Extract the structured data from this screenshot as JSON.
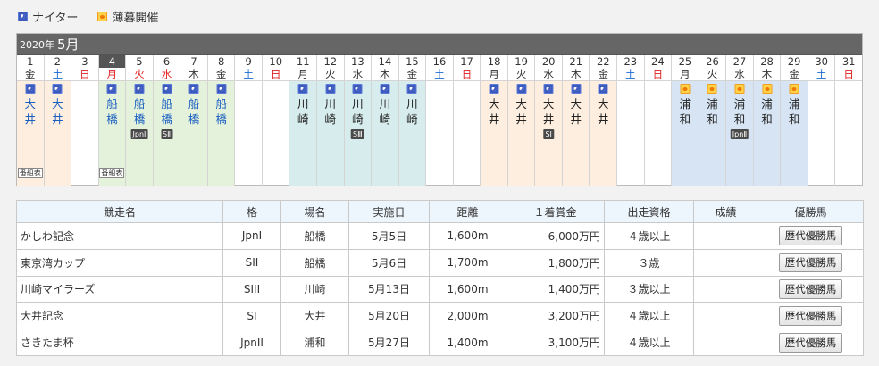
{
  "legend": {
    "night_label": "ナイター",
    "dusk_label": "薄暮開催"
  },
  "calendar": {
    "year": "2020年",
    "month": "5月",
    "days": [
      {
        "num": "1",
        "dow": "金",
        "type": "wk",
        "venue": "大井",
        "icon": "night",
        "bg": "oi",
        "vcls": "oi1",
        "prog": "番組表"
      },
      {
        "num": "2",
        "dow": "土",
        "type": "sat",
        "venue": "大井",
        "icon": "night",
        "bg": "oi",
        "vcls": "oi1"
      },
      {
        "num": "3",
        "dow": "日",
        "type": "sun"
      },
      {
        "num": "4",
        "dow": "月",
        "type": "sun",
        "today": true,
        "venue": "船橋",
        "icon": "night",
        "bg": "funa",
        "vcls": "funa",
        "prog": "番組表"
      },
      {
        "num": "5",
        "dow": "火",
        "type": "sun",
        "venue": "船橋",
        "icon": "night",
        "bg": "funa",
        "vcls": "funa",
        "grade": "JpnⅠ"
      },
      {
        "num": "6",
        "dow": "水",
        "type": "sun",
        "venue": "船橋",
        "icon": "night",
        "bg": "funa",
        "vcls": "funa",
        "grade": "SⅡ"
      },
      {
        "num": "7",
        "dow": "木",
        "type": "wk",
        "venue": "船橋",
        "icon": "night",
        "bg": "funa",
        "vcls": "funa"
      },
      {
        "num": "8",
        "dow": "金",
        "type": "wk",
        "venue": "船橋",
        "icon": "night",
        "bg": "funa",
        "vcls": "funa"
      },
      {
        "num": "9",
        "dow": "土",
        "type": "sat"
      },
      {
        "num": "10",
        "dow": "日",
        "type": "sun"
      },
      {
        "num": "11",
        "dow": "月",
        "type": "wk",
        "venue": "川崎",
        "icon": "night",
        "bg": "kawa",
        "vcls": "kawa"
      },
      {
        "num": "12",
        "dow": "火",
        "type": "wk",
        "venue": "川崎",
        "icon": "night",
        "bg": "kawa",
        "vcls": "kawa"
      },
      {
        "num": "13",
        "dow": "水",
        "type": "wk",
        "venue": "川崎",
        "icon": "night",
        "bg": "kawa",
        "vcls": "kawa",
        "grade": "SⅢ"
      },
      {
        "num": "14",
        "dow": "木",
        "type": "wk",
        "venue": "川崎",
        "icon": "night",
        "bg": "kawa",
        "vcls": "kawa"
      },
      {
        "num": "15",
        "dow": "金",
        "type": "wk",
        "venue": "川崎",
        "icon": "night",
        "bg": "kawa",
        "vcls": "kawa"
      },
      {
        "num": "16",
        "dow": "土",
        "type": "sat"
      },
      {
        "num": "17",
        "dow": "日",
        "type": "sun"
      },
      {
        "num": "18",
        "dow": "月",
        "type": "wk",
        "venue": "大井",
        "icon": "night",
        "bg": "oi",
        "vcls": "oi"
      },
      {
        "num": "19",
        "dow": "火",
        "type": "wk",
        "venue": "大井",
        "icon": "night",
        "bg": "oi",
        "vcls": "oi"
      },
      {
        "num": "20",
        "dow": "水",
        "type": "wk",
        "venue": "大井",
        "icon": "night",
        "bg": "oi",
        "vcls": "oi",
        "grade": "SⅠ"
      },
      {
        "num": "21",
        "dow": "木",
        "type": "wk",
        "venue": "大井",
        "icon": "night",
        "bg": "oi",
        "vcls": "oi"
      },
      {
        "num": "22",
        "dow": "金",
        "type": "wk",
        "venue": "大井",
        "icon": "night",
        "bg": "oi",
        "vcls": "oi"
      },
      {
        "num": "23",
        "dow": "土",
        "type": "sat"
      },
      {
        "num": "24",
        "dow": "日",
        "type": "sun"
      },
      {
        "num": "25",
        "dow": "月",
        "type": "wk",
        "venue": "浦和",
        "icon": "dusk",
        "bg": "ura",
        "vcls": "ura"
      },
      {
        "num": "26",
        "dow": "火",
        "type": "wk",
        "venue": "浦和",
        "icon": "dusk",
        "bg": "ura",
        "vcls": "ura"
      },
      {
        "num": "27",
        "dow": "水",
        "type": "wk",
        "venue": "浦和",
        "icon": "dusk",
        "bg": "ura",
        "vcls": "ura",
        "grade": "JpnⅡ"
      },
      {
        "num": "28",
        "dow": "木",
        "type": "wk",
        "venue": "浦和",
        "icon": "dusk",
        "bg": "ura",
        "vcls": "ura"
      },
      {
        "num": "29",
        "dow": "金",
        "type": "wk",
        "venue": "浦和",
        "icon": "dusk",
        "bg": "ura",
        "vcls": "ura"
      },
      {
        "num": "30",
        "dow": "土",
        "type": "sat"
      },
      {
        "num": "31",
        "dow": "日",
        "type": "sun"
      }
    ]
  },
  "races": {
    "headers": [
      "競走名",
      "格",
      "場名",
      "実施日",
      "距離",
      "１着賞金",
      "出走資格",
      "成績",
      "優勝馬"
    ],
    "button_label": "歴代優勝馬",
    "rows": [
      [
        "かしわ記念",
        "JpnI",
        "船橋",
        "5月5日",
        "1,600m",
        "6,000万円",
        "４歳以上",
        ""
      ],
      [
        "東京湾カップ",
        "SII",
        "船橋",
        "5月6日",
        "1,700m",
        "1,800万円",
        "３歳",
        ""
      ],
      [
        "川崎マイラーズ",
        "SIII",
        "川崎",
        "5月13日",
        "1,600m",
        "1,400万円",
        "３歳以上",
        ""
      ],
      [
        "大井記念",
        "SI",
        "大井",
        "5月20日",
        "2,000m",
        "3,200万円",
        "４歳以上",
        ""
      ],
      [
        "さきたま杯",
        "JpnII",
        "浦和",
        "5月27日",
        "1,400m",
        "3,100万円",
        "４歳以上",
        ""
      ]
    ]
  }
}
